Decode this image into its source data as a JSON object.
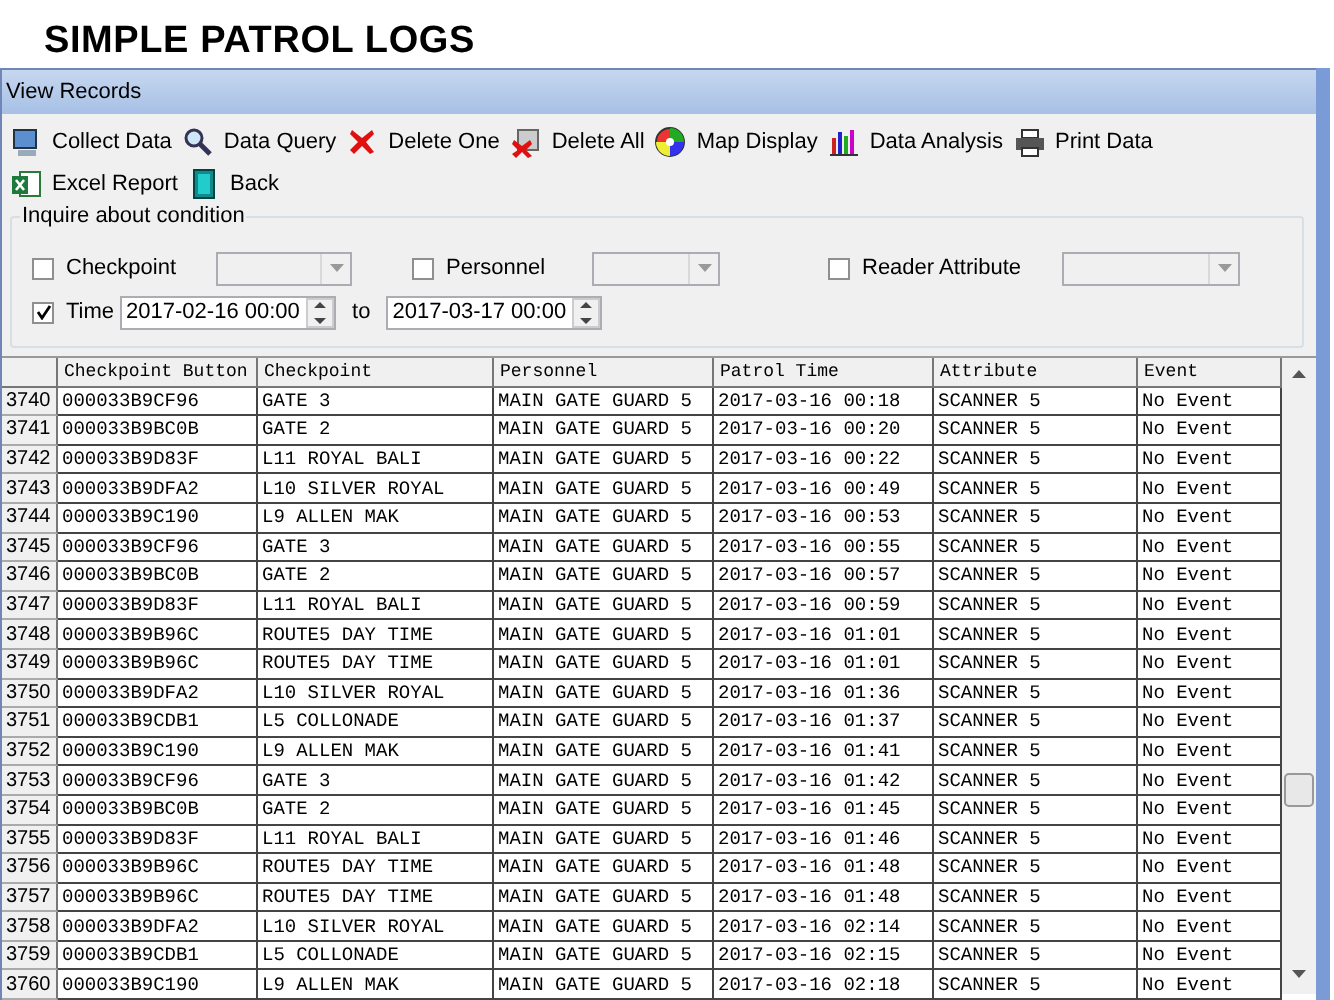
{
  "page_title": "SIMPLE PATROL LOGS",
  "window": {
    "title": "View Records"
  },
  "toolbar": [
    {
      "label": "Collect Data"
    },
    {
      "label": "Data Query"
    },
    {
      "label": "Delete One"
    },
    {
      "label": "Delete All"
    },
    {
      "label": "Map Display"
    },
    {
      "label": "Data Analysis"
    },
    {
      "label": "Print Data"
    },
    {
      "label": "Excel Report"
    },
    {
      "label": "Back"
    }
  ],
  "condition": {
    "legend": "Inquire about condition",
    "filters": [
      {
        "label": "Checkpoint",
        "checked": false
      },
      {
        "label": "Personnel",
        "checked": false
      },
      {
        "label": "Reader Attribute",
        "checked": false
      }
    ],
    "time": {
      "label": "Time",
      "checked": true,
      "from": "2017-02-16 00:00",
      "to_label": "to",
      "to": "2017-03-17 00:00"
    }
  },
  "table": {
    "columns": [
      "Checkpoint Button",
      "Checkpoint",
      "Personnel",
      "Patrol Time",
      "Attribute",
      "Event"
    ],
    "rows": [
      {
        "num": "3740",
        "cells": [
          "000033B9CF96",
          "GATE 3",
          "MAIN GATE GUARD 5",
          "2017-03-16 00:18",
          "SCANNER 5",
          "No Event"
        ]
      },
      {
        "num": "3741",
        "cells": [
          "000033B9BC0B",
          "GATE 2",
          "MAIN GATE GUARD 5",
          "2017-03-16 00:20",
          "SCANNER 5",
          "No Event"
        ]
      },
      {
        "num": "3742",
        "cells": [
          "000033B9D83F",
          "L11 ROYAL BALI",
          "MAIN GATE GUARD 5",
          "2017-03-16 00:22",
          "SCANNER 5",
          "No Event"
        ]
      },
      {
        "num": "3743",
        "cells": [
          "000033B9DFA2",
          "L10 SILVER ROYAL",
          "MAIN GATE GUARD 5",
          "2017-03-16 00:49",
          "SCANNER 5",
          "No Event"
        ]
      },
      {
        "num": "3744",
        "cells": [
          "000033B9C190",
          "L9 ALLEN MAK",
          "MAIN GATE GUARD 5",
          "2017-03-16 00:53",
          "SCANNER 5",
          "No Event"
        ]
      },
      {
        "num": "3745",
        "cells": [
          "000033B9CF96",
          "GATE 3",
          "MAIN GATE GUARD 5",
          "2017-03-16 00:55",
          "SCANNER 5",
          "No Event"
        ]
      },
      {
        "num": "3746",
        "cells": [
          "000033B9BC0B",
          "GATE 2",
          "MAIN GATE GUARD 5",
          "2017-03-16 00:57",
          "SCANNER 5",
          "No Event"
        ]
      },
      {
        "num": "3747",
        "cells": [
          "000033B9D83F",
          "L11 ROYAL BALI",
          "MAIN GATE GUARD 5",
          "2017-03-16 00:59",
          "SCANNER 5",
          "No Event"
        ]
      },
      {
        "num": "3748",
        "cells": [
          "000033B9B96C",
          "ROUTE5 DAY TIME",
          "MAIN GATE GUARD 5",
          "2017-03-16 01:01",
          "SCANNER 5",
          "No Event"
        ]
      },
      {
        "num": "3749",
        "cells": [
          "000033B9B96C",
          "ROUTE5 DAY TIME",
          "MAIN GATE GUARD 5",
          "2017-03-16 01:01",
          "SCANNER 5",
          "No Event"
        ]
      },
      {
        "num": "3750",
        "cells": [
          "000033B9DFA2",
          "L10 SILVER ROYAL",
          "MAIN GATE GUARD 5",
          "2017-03-16 01:36",
          "SCANNER 5",
          "No Event"
        ]
      },
      {
        "num": "3751",
        "cells": [
          "000033B9CDB1",
          "L5 COLLONADE",
          "MAIN GATE GUARD 5",
          "2017-03-16 01:37",
          "SCANNER 5",
          "No Event"
        ]
      },
      {
        "num": "3752",
        "cells": [
          "000033B9C190",
          "L9 ALLEN MAK",
          "MAIN GATE GUARD 5",
          "2017-03-16 01:41",
          "SCANNER 5",
          "No Event"
        ]
      },
      {
        "num": "3753",
        "cells": [
          "000033B9CF96",
          "GATE 3",
          "MAIN GATE GUARD 5",
          "2017-03-16 01:42",
          "SCANNER 5",
          "No Event"
        ]
      },
      {
        "num": "3754",
        "cells": [
          "000033B9BC0B",
          "GATE 2",
          "MAIN GATE GUARD 5",
          "2017-03-16 01:45",
          "SCANNER 5",
          "No Event"
        ]
      },
      {
        "num": "3755",
        "cells": [
          "000033B9D83F",
          "L11 ROYAL BALI",
          "MAIN GATE GUARD 5",
          "2017-03-16 01:46",
          "SCANNER 5",
          "No Event"
        ]
      },
      {
        "num": "3756",
        "cells": [
          "000033B9B96C",
          "ROUTE5 DAY TIME",
          "MAIN GATE GUARD 5",
          "2017-03-16 01:48",
          "SCANNER 5",
          "No Event"
        ]
      },
      {
        "num": "3757",
        "cells": [
          "000033B9B96C",
          "ROUTE5 DAY TIME",
          "MAIN GATE GUARD 5",
          "2017-03-16 01:48",
          "SCANNER 5",
          "No Event"
        ]
      },
      {
        "num": "3758",
        "cells": [
          "000033B9DFA2",
          "L10 SILVER ROYAL",
          "MAIN GATE GUARD 5",
          "2017-03-16 02:14",
          "SCANNER 5",
          "No Event"
        ]
      },
      {
        "num": "3759",
        "cells": [
          "000033B9CDB1",
          "L5 COLLONADE",
          "MAIN GATE GUARD 5",
          "2017-03-16 02:15",
          "SCANNER 5",
          "No Event"
        ]
      },
      {
        "num": "3760",
        "cells": [
          "000033B9C190",
          "L9 ALLEN MAK",
          "MAIN GATE GUARD 5",
          "2017-03-16 02:18",
          "SCANNER 5",
          "No Event"
        ]
      }
    ]
  }
}
